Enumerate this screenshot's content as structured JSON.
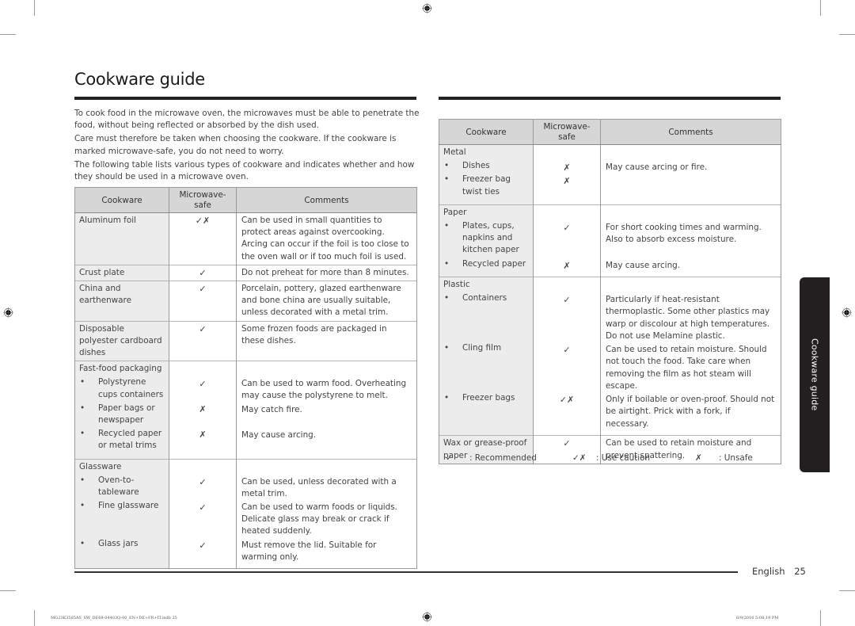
{
  "page": {
    "title": "Cookware guide",
    "side_tab": "Cookware guide",
    "footer": {
      "language": "English",
      "page_number": "25"
    },
    "slug_left": "MG23K3585AS_SW_DE68-04403Q-00_EN+DE+FR+IT.indb   25",
    "slug_right": "6/9/2016   5:08:19 PM"
  },
  "intro": [
    "To cook food in the microwave oven, the microwaves must be able to penetrate the food, without being reflected or absorbed by the dish used.",
    "Care must therefore be taken when choosing the cookware. If the cookware is marked microwave-safe, you do not need to worry.",
    "The following table lists various types of cookware and indicates whether and how they should be used in a microwave oven."
  ],
  "table_headers": {
    "cookware": "Cookware",
    "safe": "Microwave-safe",
    "comments": "Comments"
  },
  "symbols": {
    "recommended": "✓",
    "caution": "✓✗",
    "unsafe": "✗"
  },
  "left_table": [
    {
      "cookware": "Aluminum foil",
      "safe": "✓✗",
      "comment": "Can be used in small quantities to protect areas against overcooking. Arcing can occur if the foil is too close to the oven wall or if too much foil is used."
    },
    {
      "cookware": "Crust plate",
      "safe": "✓",
      "comment": "Do not preheat for more than 8 minutes."
    },
    {
      "cookware": "China and earthenware",
      "safe": "✓",
      "comment": "Porcelain, pottery, glazed earthenware and bone china are usually suitable, unless decorated with a metal trim."
    },
    {
      "cookware": "Disposable polyester cardboard dishes",
      "safe": "✓",
      "comment": "Some frozen foods are packaged in these dishes."
    },
    {
      "group": "Fast-food packaging",
      "items": [
        {
          "cookware": "Polystyrene cups containers",
          "safe": "✓",
          "comment": "Can be used to warm food. Overheating may cause the polystyrene to melt."
        },
        {
          "cookware": "Paper bags or newspaper",
          "safe": "✗",
          "comment": "May catch fire."
        },
        {
          "cookware": "Recycled paper or metal trims",
          "safe": "✗",
          "comment": "May cause arcing."
        }
      ]
    },
    {
      "group": "Glassware",
      "items": [
        {
          "cookware": "Oven-to-tableware",
          "safe": "✓",
          "comment": "Can be used, unless decorated with a metal trim."
        },
        {
          "cookware": "Fine glassware",
          "safe": "✓",
          "comment": "Can be used to warm foods or liquids. Delicate glass may break or crack if heated suddenly."
        },
        {
          "cookware": "Glass jars",
          "safe": "✓",
          "comment": "Must remove the lid. Suitable for warming only."
        }
      ]
    }
  ],
  "right_table": [
    {
      "group": "Metal",
      "items": [
        {
          "cookware": "Dishes",
          "safe": "✗",
          "comment": "May cause arcing or fire."
        },
        {
          "cookware": "Freezer bag twist ties",
          "safe": "✗",
          "comment": ""
        }
      ]
    },
    {
      "group": "Paper",
      "items": [
        {
          "cookware": "Plates, cups, napkins and kitchen paper",
          "safe": "✓",
          "comment": "For short cooking times and warming. Also to absorb excess moisture."
        },
        {
          "cookware": "Recycled paper",
          "safe": "✗",
          "comment": "May cause arcing."
        }
      ]
    },
    {
      "group": "Plastic",
      "items": [
        {
          "cookware": "Containers",
          "safe": "✓",
          "comment": "Particularly if heat-resistant thermoplastic. Some other plastics may warp or discolour at high temperatures. Do not use Melamine plastic."
        },
        {
          "cookware": "Cling film",
          "safe": "✓",
          "comment": "Can be used to retain moisture. Should not touch the food. Take care when removing the film as hot steam will escape."
        },
        {
          "cookware": "Freezer bags",
          "safe": "✓✗",
          "comment": "Only if boilable or oven-proof. Should not be airtight. Prick with a fork, if necessary."
        }
      ]
    },
    {
      "cookware": "Wax or grease-proof paper",
      "safe": "✓",
      "comment": "Can be used to retain moisture and prevent spattering."
    }
  ],
  "legend": [
    {
      "symbol": "✓",
      "label": ": Recommended"
    },
    {
      "symbol": "✓✗",
      "label": ": Use caution"
    },
    {
      "symbol": "✗",
      "label": ": Unsafe"
    }
  ]
}
